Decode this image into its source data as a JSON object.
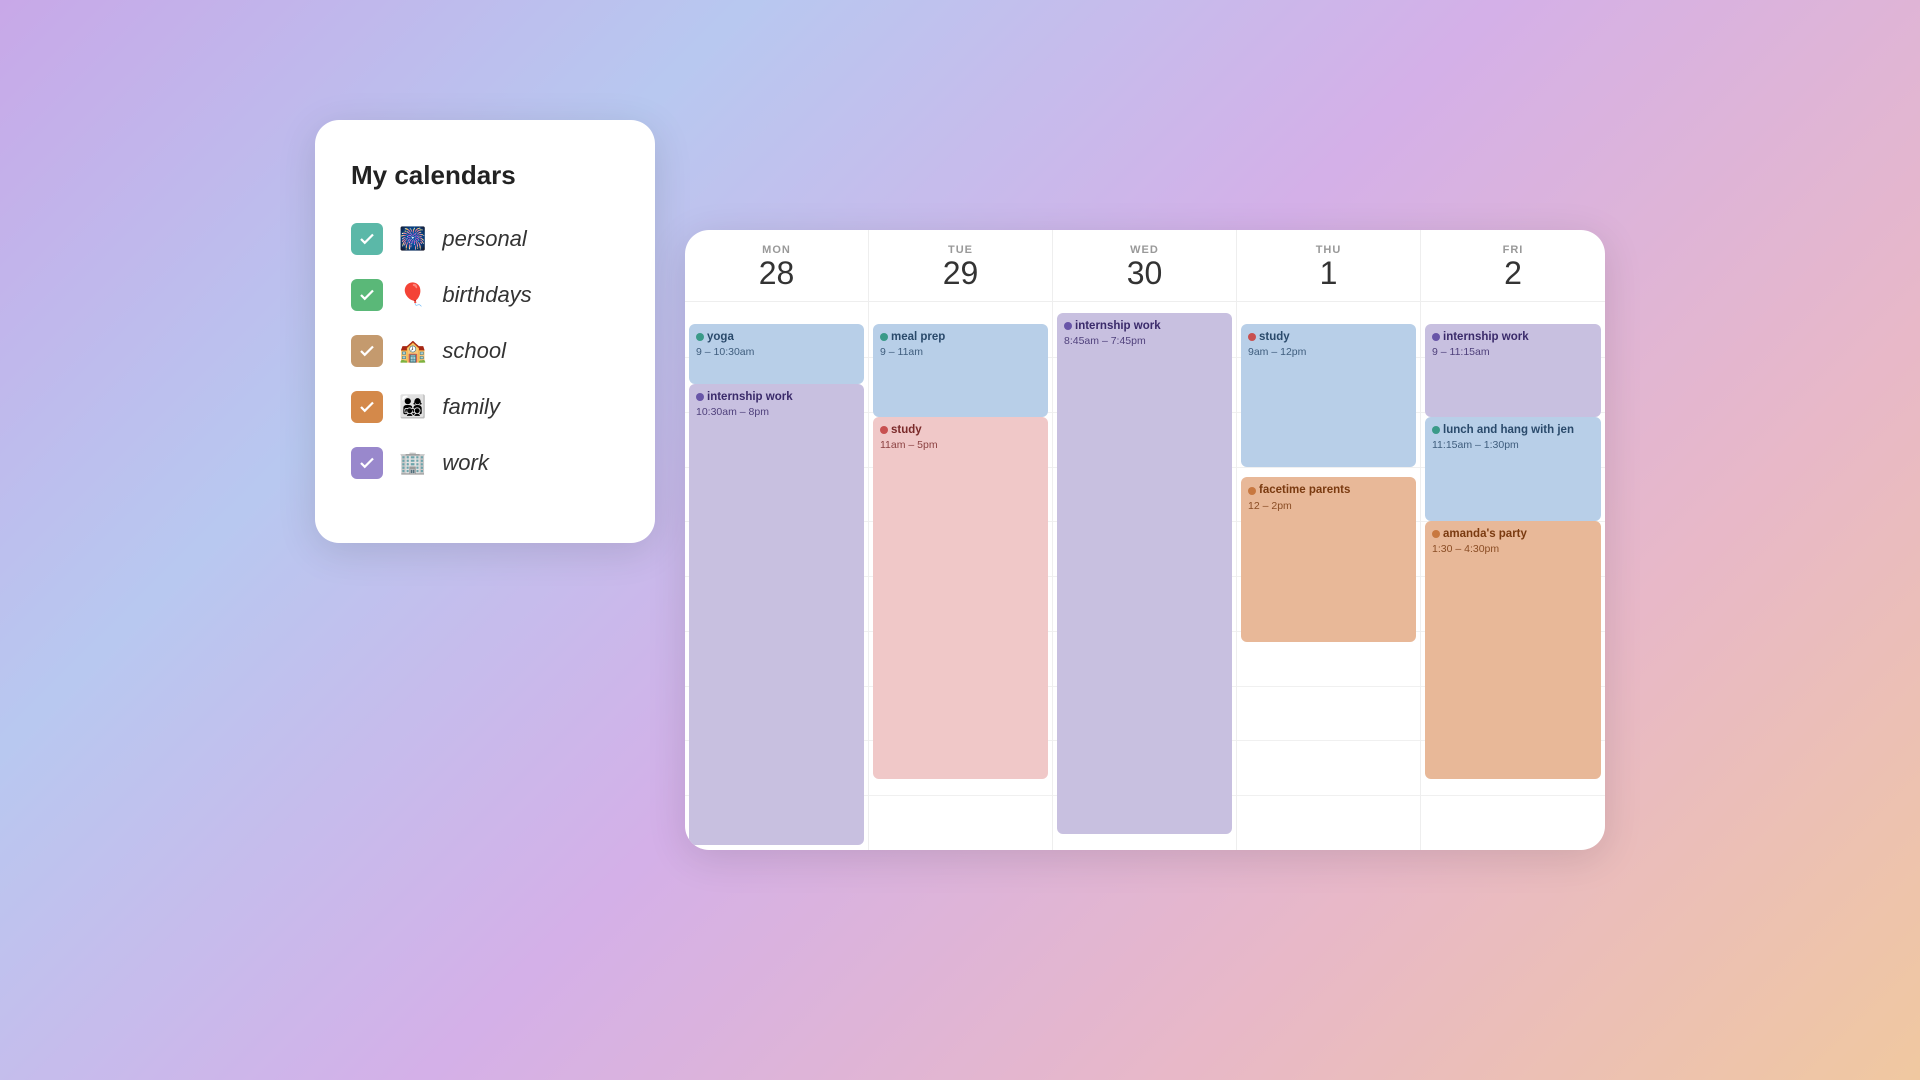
{
  "sidebar": {
    "title": "My calendars",
    "items": [
      {
        "id": "personal",
        "label": "personal",
        "emoji": "🎆",
        "color_class": "teal"
      },
      {
        "id": "birthdays",
        "label": "birthdays",
        "emoji": "🎈",
        "color_class": "green"
      },
      {
        "id": "school",
        "label": "school",
        "emoji": "🏫",
        "color_class": "brown"
      },
      {
        "id": "family",
        "label": "family",
        "emoji": "👨‍👩‍👧‍👦",
        "color_class": "orange"
      },
      {
        "id": "work",
        "label": "work",
        "emoji": "🏢",
        "color_class": "purple"
      }
    ]
  },
  "calendar": {
    "days": [
      {
        "name": "MON",
        "number": "28"
      },
      {
        "name": "TUE",
        "number": "29"
      },
      {
        "name": "WED",
        "number": "30"
      },
      {
        "name": "THU",
        "number": "1"
      },
      {
        "name": "FRI",
        "number": "2"
      }
    ],
    "events": {
      "mon": [
        {
          "title": "yoga",
          "time": "9 – 10:30am",
          "color": "ev-blue",
          "dot": "dot-teal",
          "top_pct": 4,
          "height_pct": 12
        },
        {
          "title": "internship work",
          "time": "10:30am – 8pm",
          "color": "ev-lavender",
          "dot": "dot-lavender",
          "top_pct": 15.5,
          "height_pct": 83
        }
      ],
      "tue": [
        {
          "title": "meal prep",
          "time": "9 – 11am",
          "color": "ev-blue",
          "dot": "dot-teal",
          "top_pct": 4,
          "height_pct": 18
        },
        {
          "title": "study",
          "time": "11am – 5pm",
          "color": "ev-pink",
          "dot": "dot-pink",
          "top_pct": 21,
          "height_pct": 68
        }
      ],
      "wed": [
        {
          "title": "internship work",
          "time": "8:45am – 7:45pm",
          "color": "ev-lavender",
          "dot": "dot-lavender",
          "top_pct": 2,
          "height_pct": 96
        }
      ],
      "thu": [
        {
          "title": "study",
          "time": "9am – 12pm",
          "color": "ev-blue",
          "dot": "dot-pink",
          "top_pct": 4,
          "height_pct": 28
        },
        {
          "title": "facetime parents",
          "time": "12 – 2pm",
          "color": "ev-peach",
          "dot": "dot-peach",
          "top_pct": 33,
          "height_pct": 30
        }
      ],
      "fri": [
        {
          "title": "internship work",
          "time": "9 – 11:15am",
          "color": "ev-lavender",
          "dot": "dot-lavender",
          "top_pct": 4,
          "height_pct": 19
        },
        {
          "title": "lunch and hang with jen",
          "time": "11:15am – 1:30pm",
          "color": "ev-blue",
          "dot": "dot-teal",
          "top_pct": 22,
          "height_pct": 20
        },
        {
          "title": "amanda's party",
          "time": "1:30 – 4:30pm",
          "color": "ev-peach",
          "dot": "dot-peach",
          "top_pct": 41,
          "height_pct": 46
        }
      ]
    }
  }
}
